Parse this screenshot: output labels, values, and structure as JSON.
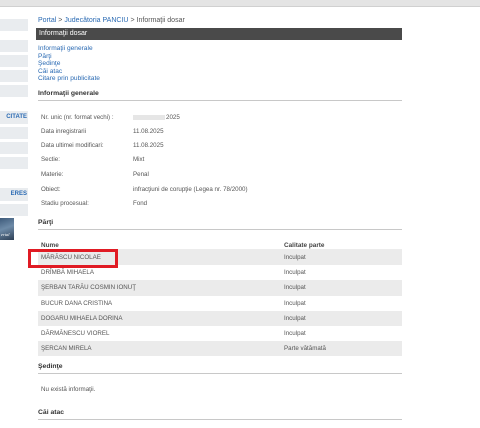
{
  "sidebar": {
    "labels": [
      "",
      "",
      "",
      "",
      "",
      "CITATE",
      "",
      "",
      "",
      "ERES",
      ""
    ],
    "image_caption": "ertal"
  },
  "breadcrumb": {
    "portal": "Portal",
    "court": "Judecătoria PANCIU",
    "current": "Informaţii dosar",
    "separator": ">"
  },
  "title": "Informaţii dosar",
  "quicklinks": [
    "Informaţii generale",
    "Părţi",
    "Şedinţe",
    "Căi atac",
    "Citare prin publicitate"
  ],
  "info": {
    "header": "Informaţii generale",
    "rows": [
      {
        "label": "Nr. unic (nr. format vechi) :",
        "value": "2025"
      },
      {
        "label": "Data inregistrarii",
        "value": "11.08.2025"
      },
      {
        "label": "Data ultimei modificari:",
        "value": "11.08.2025"
      },
      {
        "label": "Sectie:",
        "value": "Mixt"
      },
      {
        "label": "Materie:",
        "value": "Penal"
      },
      {
        "label": "Obiect:",
        "value": "infracţiuni de corupţie (Legea nr. 78/2000)"
      },
      {
        "label": "Stadiu procesual:",
        "value": "Fond"
      }
    ]
  },
  "parti": {
    "header": "Părţi",
    "col_name": "Nume",
    "col_role": "Calitate parte",
    "rows": [
      {
        "name": "MĂRĂSCU NICOLAE",
        "role": "Inculpat"
      },
      {
        "name": "DRÎMBĂ MIHAELA",
        "role": "Inculpat"
      },
      {
        "name": "ŞERBAN TARĂU COSMIN IONUŢ",
        "role": "Inculpat"
      },
      {
        "name": "BUCUR DANA CRISTINA",
        "role": "Inculpat"
      },
      {
        "name": "DOGARU MIHAELA DORINA",
        "role": "Inculpat"
      },
      {
        "name": "DĂRMĂNESCU VIOREL",
        "role": "Inculpat"
      },
      {
        "name": "ŞERCAN MIRELA",
        "role": "Parte vătămată"
      }
    ]
  },
  "sedinte": {
    "header": "Şedinţe",
    "empty": "Nu există informaţii."
  },
  "cai_atac": {
    "header": "Căi atac"
  },
  "colors": {
    "link": "#2a6ab3",
    "title_bar": "#4a4a4a",
    "highlight": "#e01b24",
    "row_alt": "#ebebeb"
  }
}
